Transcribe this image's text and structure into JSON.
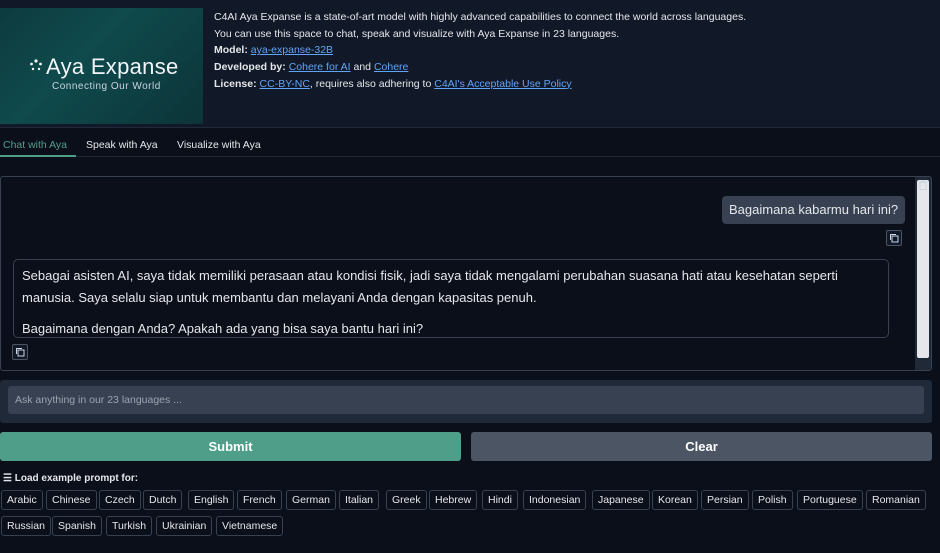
{
  "banner": {
    "title": "Aya Expanse",
    "subtitle": "Connecting Our World"
  },
  "info": {
    "line1": "C4AI Aya Expanse is a state-of-art model with highly advanced capabilities to connect the world across languages.",
    "line2": "You can use this space to chat, speak and visualize with Aya Expanse in 23 languages.",
    "model_label": "Model:",
    "model_link": "aya-expanse-32B",
    "dev_label": "Developed by:",
    "dev_link1": "Cohere for AI",
    "dev_and": "and",
    "dev_link2": "Cohere",
    "license_label": "License:",
    "license_link": "CC-BY-NC",
    "license_text": ", requires also adhering to",
    "policy_link": "C4AI's Acceptable Use Policy"
  },
  "tabs": [
    "Chat with Aya",
    "Speak with Aya",
    "Visualize with Aya"
  ],
  "chat": {
    "user_message": "Bagaimana kabarmu hari ini?",
    "bot_para1": "Sebagai asisten AI, saya tidak memiliki perasaan atau kondisi fisik, jadi saya tidak mengalami perubahan suasana hati atau kesehatan seperti manusia. Saya selalu siap untuk membantu dan melayani Anda dengan kapasitas penuh.",
    "bot_para2": "Bagaimana dengan Anda? Apakah ada yang bisa saya bantu hari ini?"
  },
  "input": {
    "placeholder": "Ask anything in our 23 languages ..."
  },
  "buttons": {
    "submit": "Submit",
    "clear": "Clear"
  },
  "examples": {
    "label": "☰ Load example prompt for:",
    "row1": [
      "Arabic",
      "Chinese",
      "Czech",
      "Dutch",
      "English",
      "French",
      "German",
      "Italian",
      "Greek",
      "Hebrew",
      "Hindi",
      "Indonesian",
      "Japanese",
      "Korean",
      "Persian",
      "Polish",
      "Portuguese",
      "Romanian"
    ],
    "row2": [
      "Russian",
      "Spanish",
      "Turkish",
      "Ukrainian",
      "Vietnamese"
    ]
  },
  "colors": {
    "accent": "#4f9e8a",
    "background": "#0b0f19",
    "link": "#60a5fa"
  }
}
